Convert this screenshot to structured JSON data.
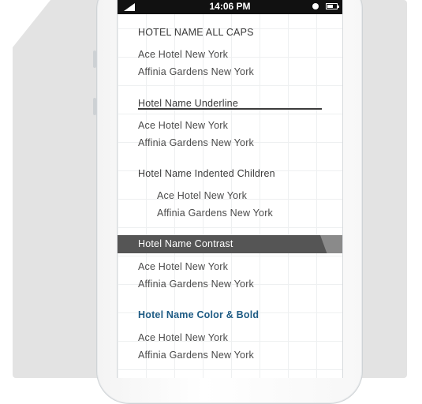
{
  "status_bar": {
    "time": "14:06 PM",
    "battery_level": 0.6
  },
  "sections": {
    "all_caps": {
      "title": "HOTEL NAME ALL CAPS",
      "items": [
        "Ace Hotel New York",
        "Affinia Gardens New York"
      ]
    },
    "underline": {
      "title": "Hotel Name Underline",
      "items": [
        "Ace Hotel New York",
        "Affinia Gardens New York"
      ]
    },
    "indented": {
      "title": "Hotel Name Indented Children",
      "items": [
        "Ace Hotel New York",
        "Affinia Gardens New York"
      ]
    },
    "contrast": {
      "title": "Hotel Name Contrast",
      "items": [
        "Ace Hotel New York",
        "Affinia Gardens New York"
      ],
      "bar_color": "#555555"
    },
    "color_bold": {
      "title": "Hotel Name Color & Bold",
      "items": [
        "Ace Hotel New York",
        "Affinia Gardens New York"
      ],
      "title_color": "#1e5b84"
    }
  }
}
